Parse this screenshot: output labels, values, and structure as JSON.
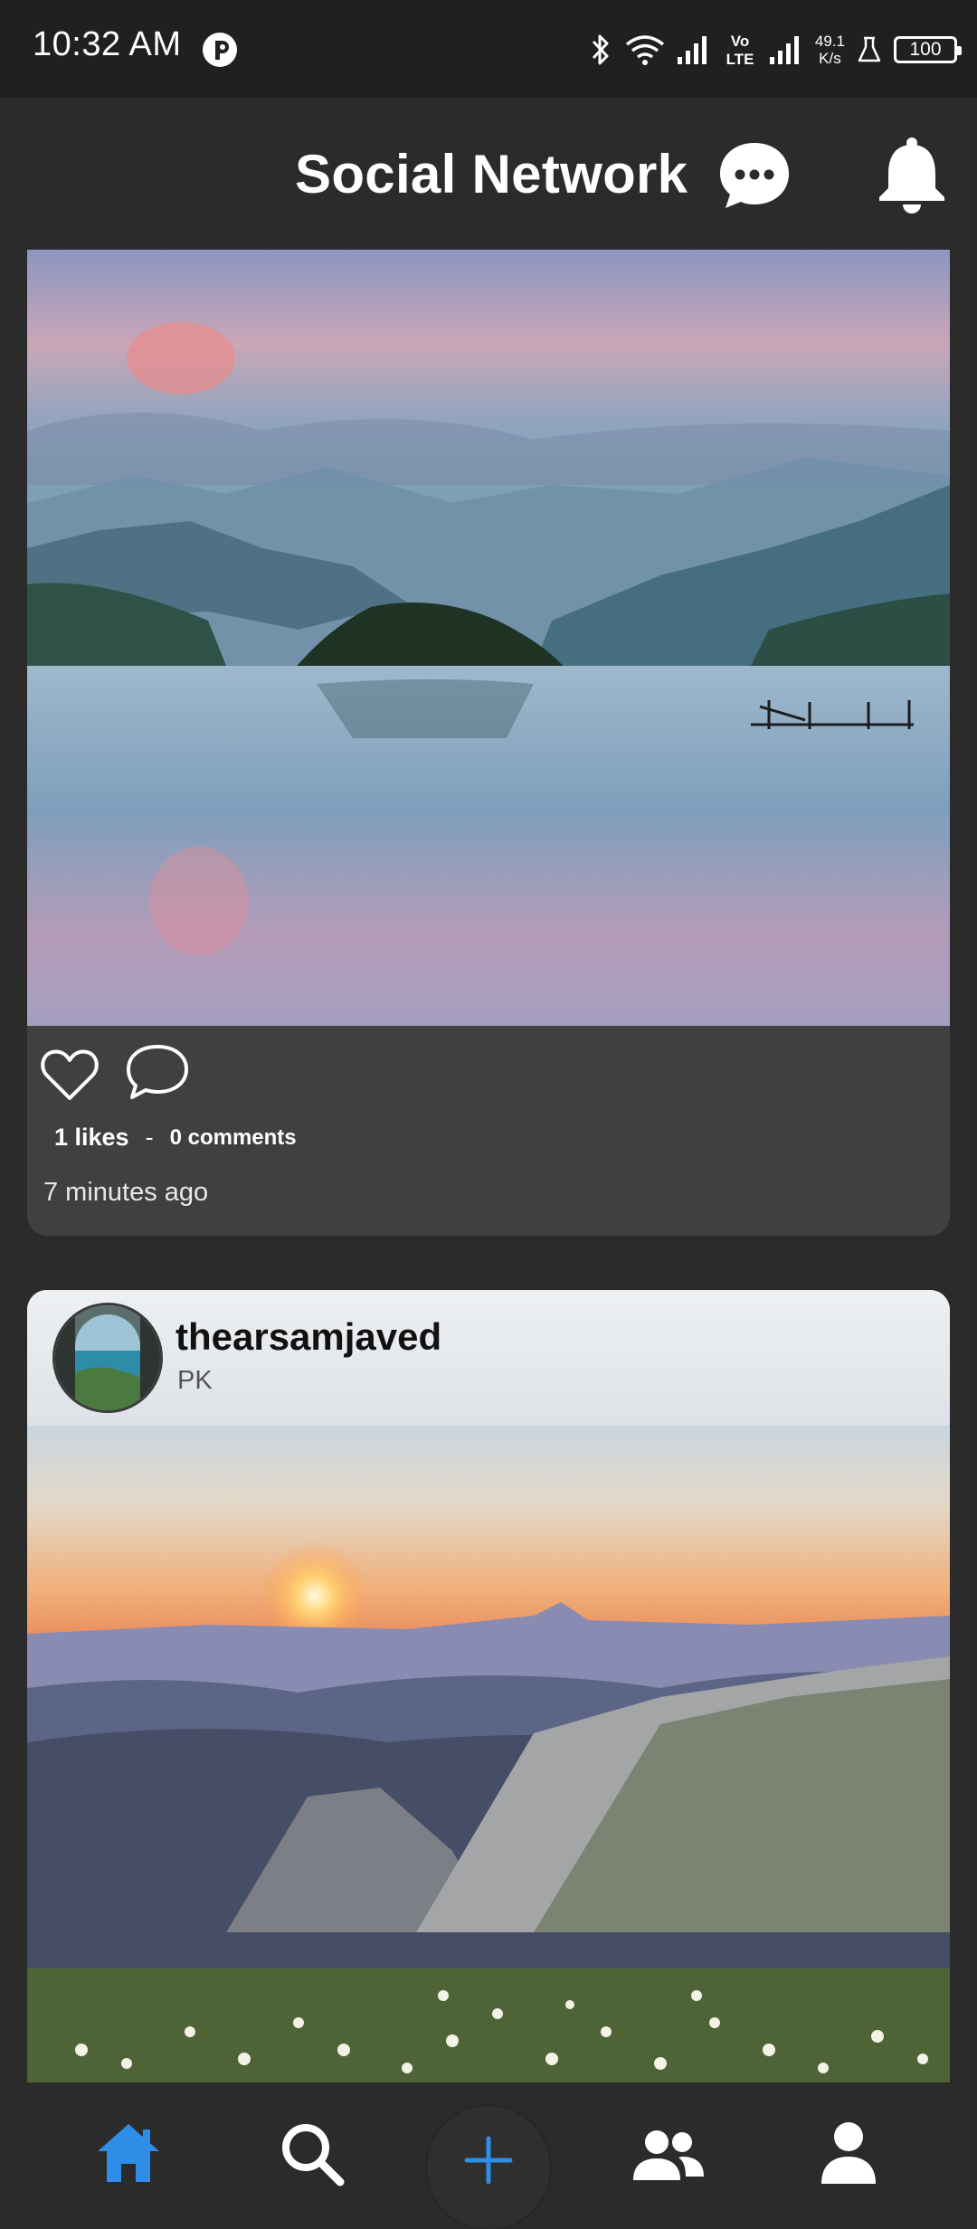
{
  "status_bar": {
    "time": "10:32 AM",
    "net_speed_value": "49.1",
    "net_speed_unit": "K/s",
    "battery": "100",
    "icons": [
      "bluetooth-icon",
      "wifi-icon",
      "signal-icon",
      "volte-icon",
      "signal-icon",
      "lab-icon",
      "battery-icon"
    ]
  },
  "header": {
    "title": "Social Network",
    "icons": [
      "chat-icon",
      "bell-icon"
    ]
  },
  "posts": [
    {
      "image": "landscape-lake-photo",
      "likes": "1 likes",
      "separator": "-",
      "comments": "0 comments",
      "time": "7 minutes ago"
    },
    {
      "username": "thearsamjaved",
      "location": "PK",
      "image": "mountain-sunset-photo"
    }
  ],
  "bottom_nav": {
    "items": [
      "home-icon",
      "search-icon",
      "add-icon",
      "friends-icon",
      "profile-icon"
    ],
    "active": "home",
    "accent": "#2e8de6"
  }
}
